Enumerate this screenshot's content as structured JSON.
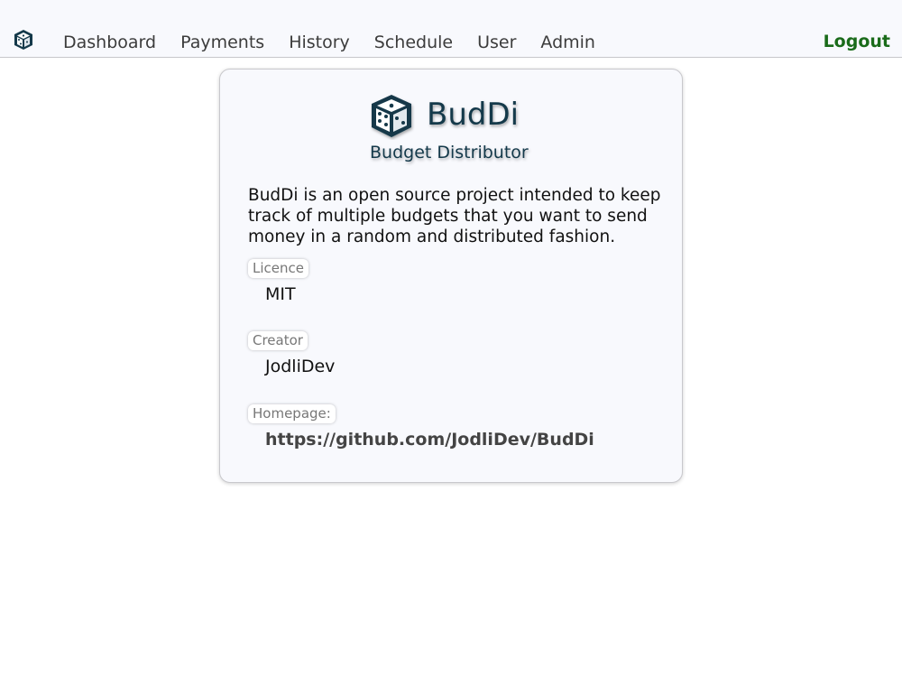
{
  "nav": {
    "logo_icon": "dice-icon",
    "links": [
      "Dashboard",
      "Payments",
      "History",
      "Schedule",
      "User",
      "Admin"
    ],
    "logout": "Logout",
    "logout_color": "#1a6b1a"
  },
  "about": {
    "brand_name": "BudDi",
    "brand_tagline": "Budget Distributor",
    "brand_color": "#14394a",
    "description": "BudDi is an open source project intended to keep track of multiple budgets that you want to send money in a random and distributed fashion.",
    "licence_label": "Licence",
    "licence_value": "MIT",
    "creator_label": "Creator",
    "creator_value": "JodliDev",
    "homepage_label": "Homepage:",
    "homepage_value": "https://github.com/JodliDev/BudDi"
  }
}
